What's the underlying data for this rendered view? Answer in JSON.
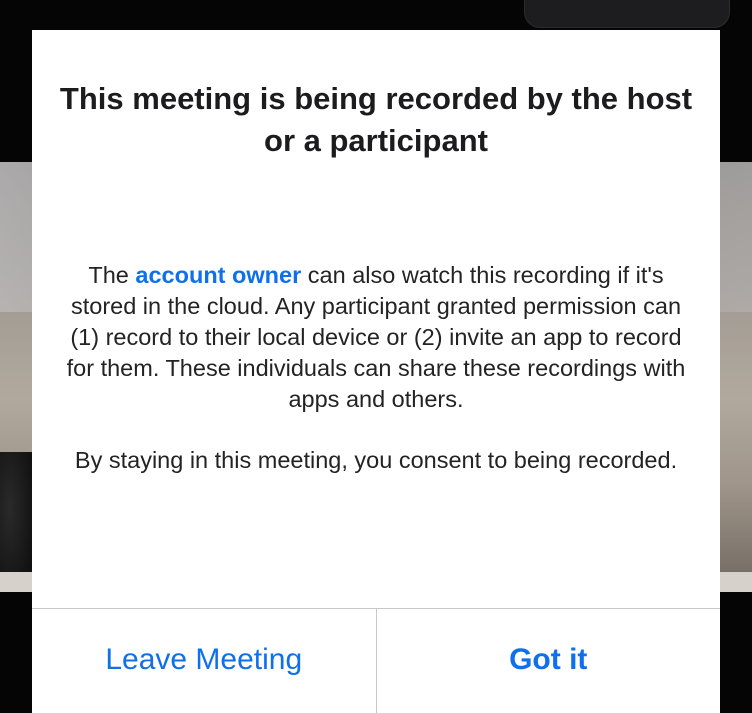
{
  "dialog": {
    "title": "This meeting is being recorded by the host or a participant",
    "body_link": "account owner",
    "body_pre": "The ",
    "body_post": " can also watch this recording if it's stored in the cloud. Any participant granted permission can (1) record to their local device or (2) invite an app to record for them. These individuals can share these recordings with apps and others.",
    "consent": "By staying in this meeting, you consent to being recorded.",
    "leave_label": "Leave Meeting",
    "confirm_label": "Got it"
  },
  "colors": {
    "accent": "#0e71eb",
    "text": "#232323",
    "dialog_bg": "#ffffff",
    "divider": "#c8c8cc"
  }
}
